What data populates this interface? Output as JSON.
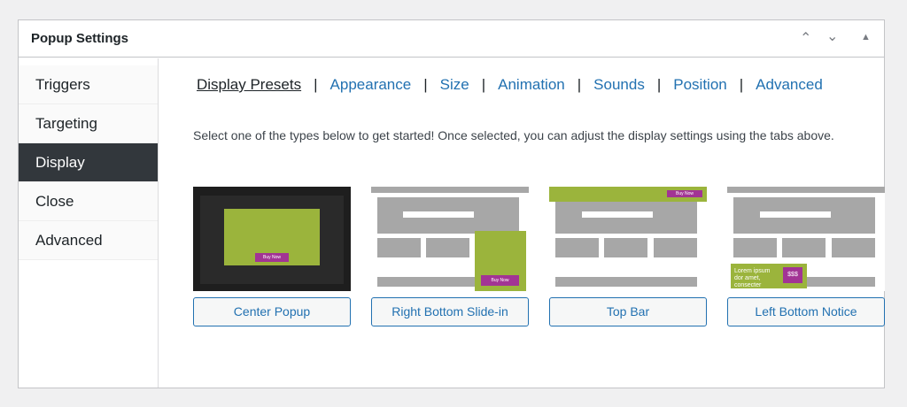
{
  "panel": {
    "title": "Popup Settings",
    "icons": [
      "chevron-up-icon",
      "chevron-down-icon",
      "triangle-up-icon"
    ]
  },
  "sidebar": {
    "items": [
      {
        "label": "Triggers"
      },
      {
        "label": "Targeting"
      },
      {
        "label": "Display",
        "active": true
      },
      {
        "label": "Close"
      },
      {
        "label": "Advanced"
      }
    ]
  },
  "tabs": [
    {
      "label": "Display Presets",
      "active": true
    },
    {
      "label": "Appearance"
    },
    {
      "label": "Size"
    },
    {
      "label": "Animation"
    },
    {
      "label": "Sounds"
    },
    {
      "label": "Position"
    },
    {
      "label": "Advanced"
    }
  ],
  "description": "Select one of the types below to get started! Once selected, you can adjust the display settings using the tabs above.",
  "presets": [
    {
      "label": "Center Popup",
      "thumb_button": "Buy Now"
    },
    {
      "label": "Right Bottom Slide-in",
      "thumb_button": "Buy Now"
    },
    {
      "label": "Top Bar",
      "thumb_button": "Buy Now"
    },
    {
      "label": "Left Bottom Notice",
      "thumb_text": "Lorem ipsum dor amet, consecter",
      "thumb_button": "$$$"
    }
  ],
  "colors": {
    "accent": "#2271b1",
    "active_bg": "#32373c",
    "thumb_green": "#9bb43c",
    "thumb_purple": "#a23494"
  }
}
